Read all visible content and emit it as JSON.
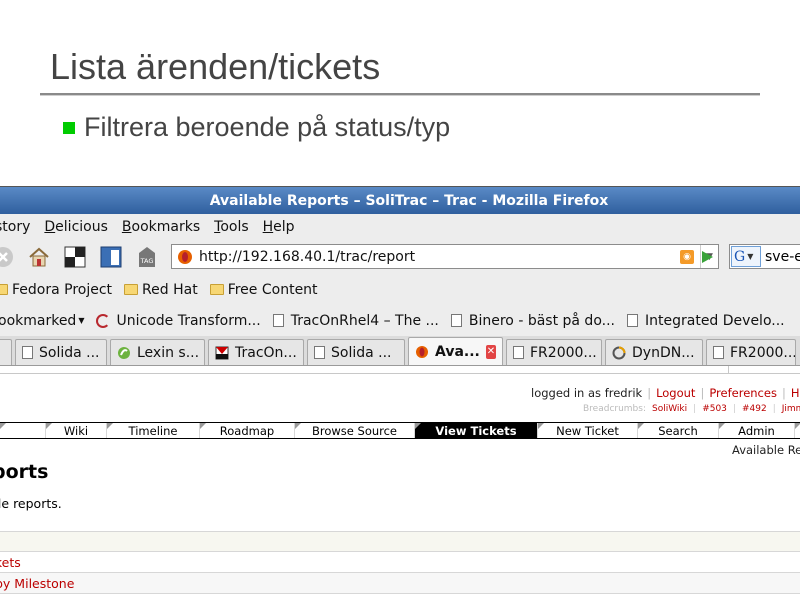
{
  "slide": {
    "title": "Lista ärenden/tickets",
    "bullet": "Filtrera beroende på status/typ",
    "bullet_color": "#00cc00"
  },
  "browser": {
    "window_title": "Available Reports – SoliTrac – Trac - Mozilla Firefox",
    "menu": [
      {
        "label": "story"
      },
      {
        "label": "Delicious"
      },
      {
        "label": "Bookmarks"
      },
      {
        "label": "Tools"
      },
      {
        "label": "Help"
      }
    ],
    "url": "http://192.168.40.1/trac/report",
    "search_value": "sve-e",
    "bookmarks_toolbar": [
      {
        "label": "Fedora Project",
        "icon": "folder-icon"
      },
      {
        "label": "Red Hat",
        "icon": "folder-icon"
      },
      {
        "label": "Free Content",
        "icon": "folder-icon"
      }
    ],
    "bookmarks_toolbar2": [
      {
        "label": "ookmarked",
        "icon": "dropdown"
      },
      {
        "label": "Unicode Transform...",
        "icon": "spiral-icon"
      },
      {
        "label": "TracOnRhel4 – The ...",
        "icon": "page-icon"
      },
      {
        "label": "Binero - bäst på do...",
        "icon": "page-icon"
      },
      {
        "label": "Integrated Develo...",
        "icon": "page-icon"
      }
    ],
    "tabs": [
      {
        "label": "Solida ...",
        "icon": "page-icon"
      },
      {
        "label": "Lexin s...",
        "icon": "lexin-icon"
      },
      {
        "label": "TracOn...",
        "icon": "trac-icon"
      },
      {
        "label": "Solida ...",
        "icon": "page-icon"
      },
      {
        "label": "Ava...",
        "icon": "firefox-icon",
        "active": true
      },
      {
        "label": "FR2000...",
        "icon": "page-icon"
      },
      {
        "label": "DynDN...",
        "icon": "dyndns-icon"
      },
      {
        "label": "FR2000...",
        "icon": "page-icon"
      }
    ]
  },
  "trac": {
    "meta": {
      "logged_in": "logged in as fredrik",
      "logout": "Logout",
      "preferences": "Preferences",
      "help": "He"
    },
    "breadcrumbs": {
      "label": "Breadcrumbs:",
      "items": [
        "SoliWiki",
        "#503",
        "#492",
        "Jimm"
      ]
    },
    "nav": [
      {
        "label": ""
      },
      {
        "label": "Wiki"
      },
      {
        "label": "Timeline"
      },
      {
        "label": "Roadmap"
      },
      {
        "label": "Browse Source"
      },
      {
        "label": "View Tickets",
        "active": true
      },
      {
        "label": "New Ticket"
      },
      {
        "label": "Search"
      },
      {
        "label": "Admin"
      },
      {
        "label": ""
      }
    ],
    "context_nav": "Available Rep",
    "page_title": "ports",
    "description": "ble reports.",
    "reports": [
      {
        "label": "ckets"
      },
      {
        "label": "by Milestone"
      }
    ],
    "link_color": "#b00000"
  }
}
